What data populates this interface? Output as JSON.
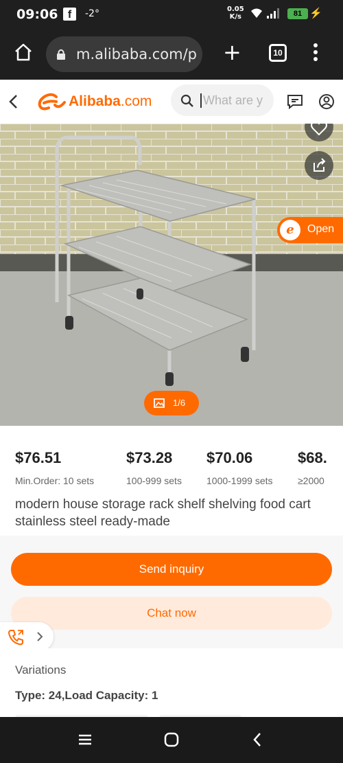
{
  "status_bar": {
    "time": "09:06",
    "notification_app": "f",
    "temperature": "-2°",
    "net_speed_value": "0.05",
    "net_speed_unit": "K/s",
    "battery": "81"
  },
  "browser": {
    "url": "m.alibaba.com/pr",
    "tab_count": "10"
  },
  "header": {
    "brand_name": "Alibaba",
    "brand_tld": ".com",
    "search_placeholder": "What are y"
  },
  "gallery": {
    "open_label": "Open",
    "counter": "1/6"
  },
  "pricing": {
    "tiers": [
      {
        "price": "$76.51",
        "qty": "Min.Order: 10 sets"
      },
      {
        "price": "$73.28",
        "qty": "100-999 sets"
      },
      {
        "price": "$70.06",
        "qty": "1000-1999 sets"
      },
      {
        "price": "$68.",
        "qty": "≥2000"
      }
    ]
  },
  "product": {
    "title": "modern house storage rack shelf shelving food cart stainless steel ready-made"
  },
  "actions": {
    "send_inquiry": "Send inquiry",
    "chat_now": "Chat now"
  },
  "variations": {
    "heading": "Variations",
    "value": "Type: 24,Load Capacity: 1"
  },
  "colors": {
    "accent": "#ff6a00",
    "accent_light": "#ffeadc",
    "system_bar": "#1f1f1f"
  },
  "icons": [
    "home-icon",
    "lock-icon",
    "plus-icon",
    "tabs-icon",
    "more-vert-icon",
    "back-arrow-icon",
    "search-icon",
    "message-icon",
    "account-icon",
    "heart-icon",
    "share-icon",
    "image-icon",
    "phone-icon",
    "chevron-right-icon",
    "recents-icon",
    "home-circle-icon",
    "nav-back-icon"
  ]
}
